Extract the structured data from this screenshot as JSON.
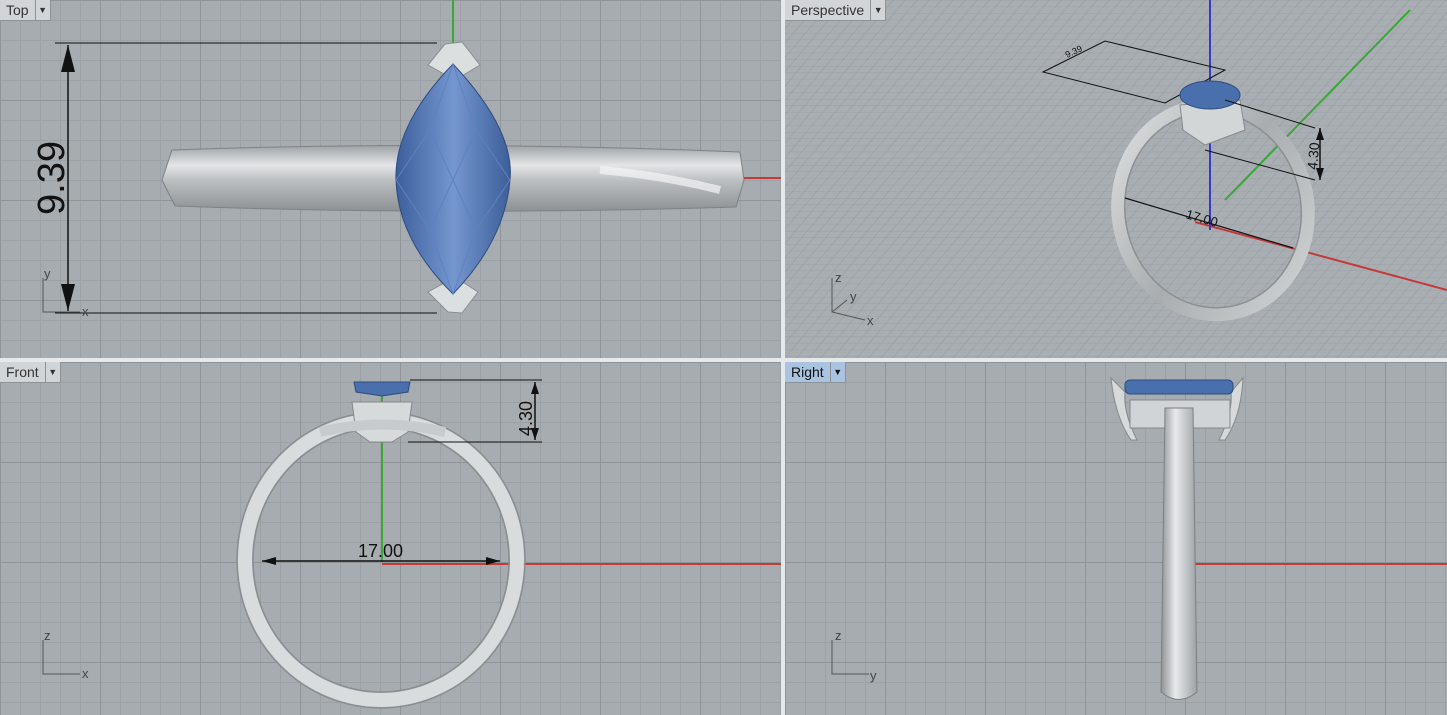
{
  "viewports": {
    "top": {
      "label": "Top",
      "dimension": "9.39",
      "axis_x": "x",
      "axis_y": "y"
    },
    "perspective": {
      "label": "Perspective",
      "dim_height": "4.30",
      "dim_diameter": "17.00",
      "dim_small": "9.39",
      "axis_x": "x",
      "axis_y": "y",
      "axis_z": "z"
    },
    "front": {
      "label": "Front",
      "dim_height": "4.30",
      "dim_diameter": "17.00",
      "axis_x": "x",
      "axis_z": "z"
    },
    "right": {
      "label": "Right",
      "axis_y": "y",
      "axis_z": "z"
    }
  },
  "colors": {
    "background": "#a7acb0",
    "gem": "#4f74b3",
    "metal": "#c8cbcd",
    "x_axis": "#c43a3a",
    "y_axis": "#39a839",
    "z_axis": "#3a3ac8",
    "active_tab": "#a9c3e0"
  }
}
